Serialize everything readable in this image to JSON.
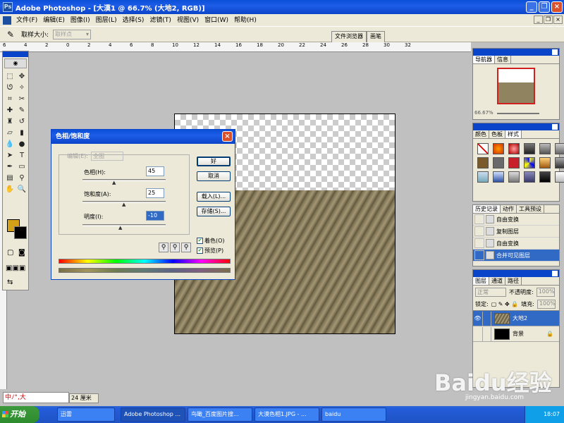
{
  "window": {
    "title": "Adobe Photoshop - [大漠1 @ 66.7% (大地2, RGB)]"
  },
  "menu": [
    "文件(F)",
    "编辑(E)",
    "图像(I)",
    "图层(L)",
    "选择(S)",
    "滤镜(T)",
    "视图(V)",
    "窗口(W)",
    "帮助(H)"
  ],
  "options": {
    "sample_label": "取样大小:",
    "sample_value": "取样点"
  },
  "well": [
    "文件浏览器",
    "画笔"
  ],
  "ruler": [
    "6",
    "4",
    "2",
    "0",
    "2",
    "4",
    "6",
    "8",
    "10",
    "12",
    "14",
    "16",
    "18",
    "20",
    "22",
    "24",
    "26",
    "28",
    "30",
    "32"
  ],
  "dialog": {
    "title": "色相/饱和度",
    "edit_label": "编辑(E):",
    "edit_value": "全图",
    "hue_label": "色相(H):",
    "hue_value": "45",
    "sat_label": "饱和度(A):",
    "sat_value": "25",
    "light_label": "明度(I):",
    "light_value": "-10",
    "ok": "好",
    "cancel": "取消",
    "load": "载入(L)...",
    "save": "存储(S)...",
    "colorize": "着色(O)",
    "preview": "预览(P)"
  },
  "navigator": {
    "tabs": [
      "导航器",
      "信息"
    ],
    "zoom": "66.67%"
  },
  "styles": {
    "tabs": [
      "颜色",
      "色板",
      "样式"
    ]
  },
  "history": {
    "tabs": [
      "历史记录",
      "动作",
      "工具预设"
    ],
    "items": [
      "自由变换",
      "复制图层",
      "自由变换",
      "合并可见图层"
    ]
  },
  "layers": {
    "tabs": [
      "图层",
      "通道",
      "路径"
    ],
    "blend": "正常",
    "opacity_label": "不透明度:",
    "opacity": "100%",
    "lock_label": "锁定:",
    "fill_label": "填充:",
    "fill": "100%",
    "items": [
      "大地2",
      "背景"
    ]
  },
  "status": {
    "zoom": "24 厘米",
    "ime": "中ﾉ°,大"
  },
  "taskbar": {
    "start": "开始",
    "tasks": [
      "迅雷",
      "Adobe Photoshop ...",
      "鸟瞰_百度图片搜...",
      "大漠色相1.JPG - ...",
      "baidu"
    ],
    "clock": "18:07"
  },
  "watermark": {
    "logo": "Baidu经验",
    "url": "jingyan.baidu.com"
  }
}
